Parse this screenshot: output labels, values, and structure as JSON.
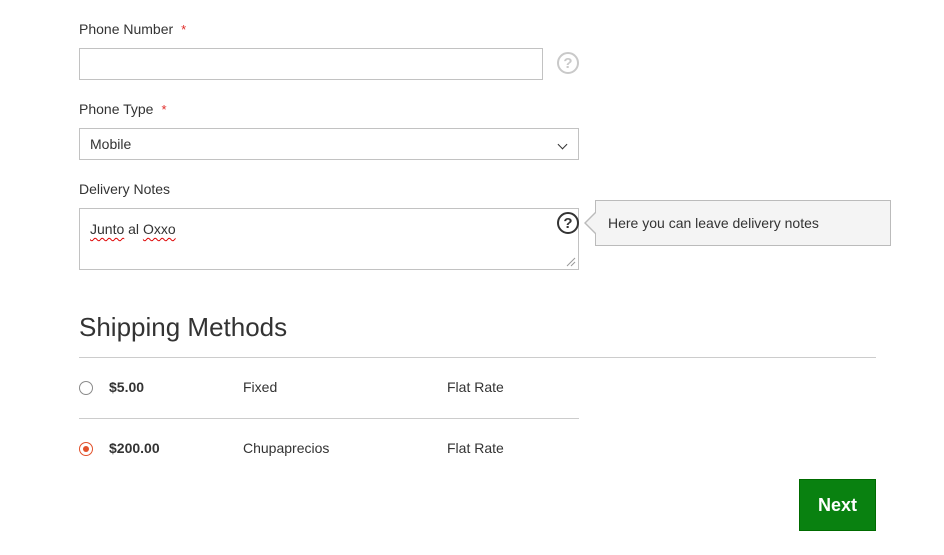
{
  "phone_number": {
    "label": "Phone Number",
    "required_mark": "*",
    "value": "",
    "help_icon": "question-circle-icon"
  },
  "phone_type": {
    "label": "Phone Type",
    "required_mark": "*",
    "selected": "Mobile"
  },
  "delivery_notes": {
    "label": "Delivery Notes",
    "words": [
      "Junto",
      "al",
      "Oxxo"
    ],
    "help_icon": "question-circle-icon",
    "tooltip": "Here you can leave delivery notes"
  },
  "shipping": {
    "title": "Shipping Methods",
    "methods": [
      {
        "price": "$5.00",
        "method": "Fixed",
        "carrier": "Flat Rate",
        "selected": false
      },
      {
        "price": "$200.00",
        "method": "Chupaprecios",
        "carrier": "Flat Rate",
        "selected": true
      }
    ]
  },
  "next_button": {
    "label": "Next",
    "color": "#098110"
  },
  "colors": {
    "required": "#e02b27",
    "radio_selected": "#e2512b"
  }
}
